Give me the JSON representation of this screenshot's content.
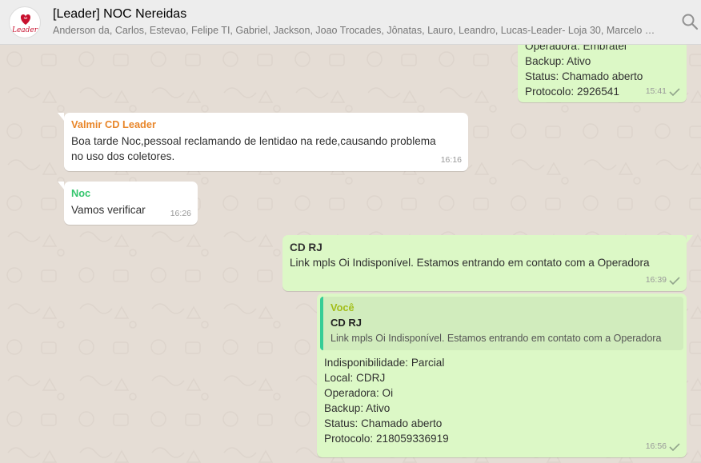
{
  "header": {
    "avatar_text": "Leader",
    "title": "[Leader] NOC Nereidas",
    "participants": "Anderson da, Carlos, Estevao, Felipe TI, Gabriel, Jackson, Joao Trocades, Jônatas, Lauro, Leandro, Lucas-Leader- Loja 30, Marcelo Ba...",
    "search_icon": "search-icon"
  },
  "colors": {
    "header_bg": "#ededed",
    "chat_bg": "#e5ddd5",
    "incoming_bubble": "#ffffff",
    "outgoing_bubble": "#dcf8c6",
    "sender_valmir": "#e8862a",
    "sender_noc": "#35c66e",
    "sender_voce": "#a3be1a",
    "read_check": "#92a58c"
  },
  "messages": [
    {
      "direction": "out",
      "lines": [
        "Operadora: Embratel",
        "Backup: Ativo",
        "Status: Chamado aberto",
        "Protocolo: 2926541"
      ],
      "time": "15:41"
    },
    {
      "direction": "in",
      "sender": "Valmir CD Leader",
      "lines": [
        "Boa tarde Noc,pessoal reclamando de lentidao na rede,causando problema",
        "no uso dos coletores."
      ],
      "time": "16:16"
    },
    {
      "direction": "in",
      "sender": "Noc",
      "lines": [
        "Vamos verificar"
      ],
      "time": "16:26"
    },
    {
      "direction": "out",
      "title": "CD RJ",
      "lines": [
        "Link mpls Oi Indisponível. Estamos entrando em contato com a Operadora"
      ],
      "time": "16:39"
    },
    {
      "direction": "out",
      "quote": {
        "sender": "Você",
        "title": "CD RJ",
        "text": "Link mpls Oi Indisponível. Estamos entrando em contato com a Operadora"
      },
      "lines": [
        "Indisponibilidade: Parcial",
        "Local: CDRJ",
        "Operadora: Oi",
        "Backup: Ativo",
        "Status: Chamado aberto",
        "Protocolo: 218059336919"
      ],
      "time": "16:56"
    }
  ]
}
